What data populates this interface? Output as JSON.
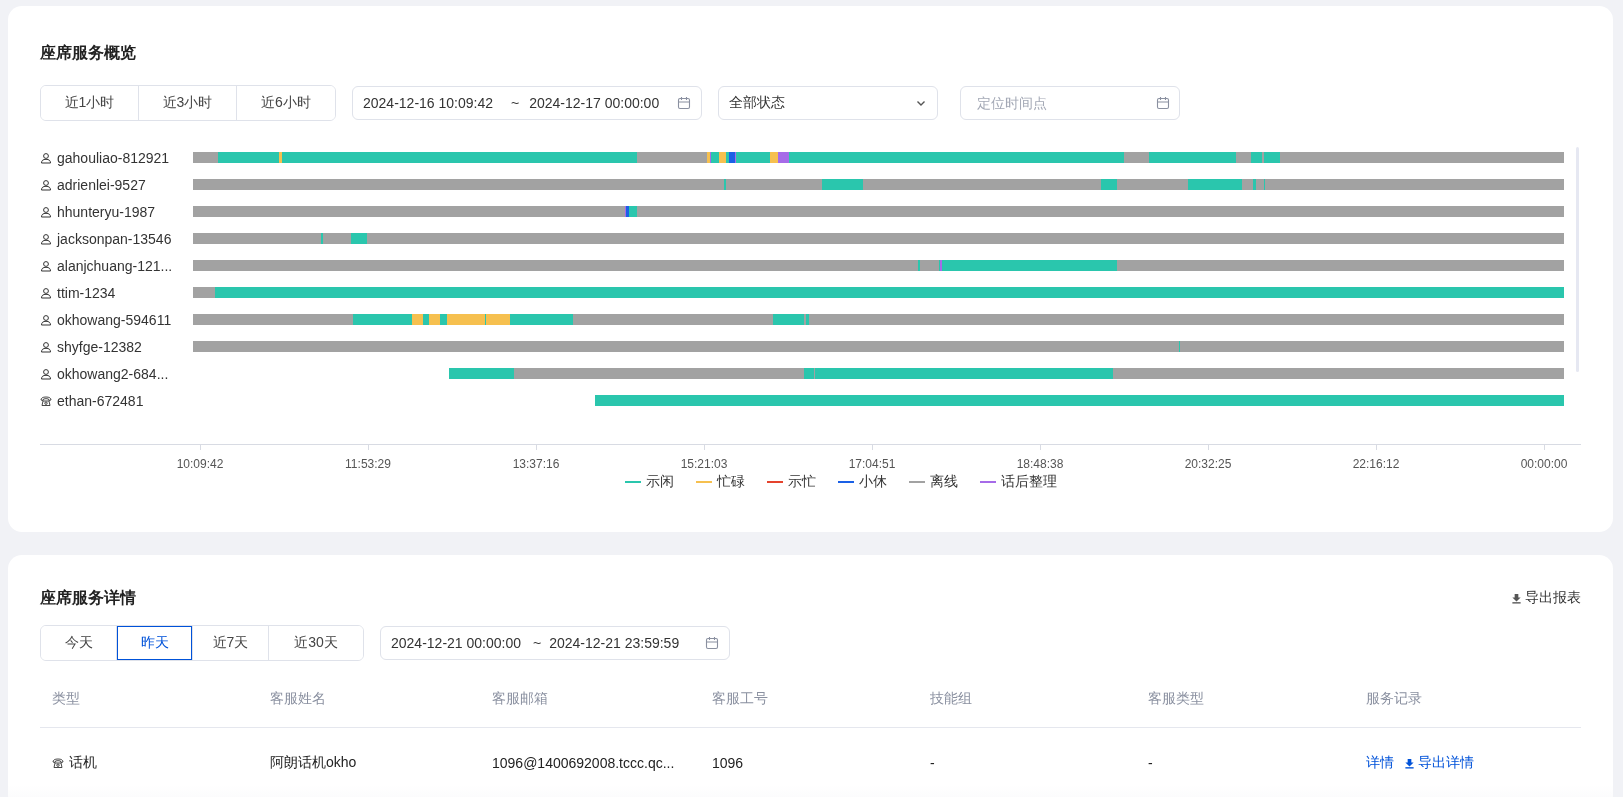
{
  "overview": {
    "title": "座席服务概览",
    "range_tabs": [
      {
        "label": "近1小时",
        "selected": false
      },
      {
        "label": "近3小时",
        "selected": false
      },
      {
        "label": "近6小时",
        "selected": false
      }
    ],
    "date_range": {
      "start": "2024-12-16 10:09:42",
      "separator": "~",
      "end": "2024-12-17 00:00:00"
    },
    "status_select": {
      "value": "全部状态"
    },
    "locate_field": {
      "placeholder": "定位时间点"
    },
    "timeline": {
      "rows": [
        {
          "name": "gahouliao-812921",
          "kind": "person"
        },
        {
          "name": "adrienlei-9527",
          "kind": "person"
        },
        {
          "name": "hhunteryu-1987",
          "kind": "person"
        },
        {
          "name": "jacksonpan-13546",
          "kind": "person"
        },
        {
          "name": "alanjchuang-121...",
          "kind": "person"
        },
        {
          "name": "ttim-1234",
          "kind": "person"
        },
        {
          "name": "okhowang-594611",
          "kind": "person"
        },
        {
          "name": "shyfge-12382",
          "kind": "person"
        },
        {
          "name": "okhowang2-684...",
          "kind": "person"
        },
        {
          "name": "ethan-672481",
          "kind": "phone"
        }
      ],
      "axis_ticks": [
        "10:09:42",
        "11:53:29",
        "13:37:16",
        "15:21:03",
        "17:04:51",
        "18:48:38",
        "20:32:25",
        "22:16:12",
        "00:00:00"
      ],
      "legend": [
        {
          "kind": "idle",
          "label": "示闲",
          "color": "#2ac6ad"
        },
        {
          "kind": "busy",
          "label": "忙碌",
          "color": "#f6c04f"
        },
        {
          "kind": "showbusy",
          "label": "示忙",
          "color": "#e5432d"
        },
        {
          "kind": "break",
          "label": "小休",
          "color": "#1a60e6"
        },
        {
          "kind": "offline",
          "label": "离线",
          "color": "#a2a2a2"
        },
        {
          "kind": "wrapup",
          "label": "话后整理",
          "color": "#a66be8"
        }
      ]
    }
  },
  "details": {
    "title": "座席服务详情",
    "export_button": "导出报表",
    "range_tabs": [
      {
        "label": "今天",
        "selected": false
      },
      {
        "label": "昨天",
        "selected": true
      },
      {
        "label": "近7天",
        "selected": false
      },
      {
        "label": "近30天",
        "selected": false
      }
    ],
    "date_range": {
      "start": "2024-12-21 00:00:00",
      "separator": "~",
      "end": "2024-12-21 23:59:59"
    },
    "table": {
      "columns": [
        "类型",
        "客服姓名",
        "客服邮箱",
        "客服工号",
        "技能组",
        "客服类型",
        "服务记录"
      ],
      "rows": [
        {
          "kind": "phone",
          "type": "话机",
          "name": "阿朗话机okho",
          "email": "1096@1400692008.tccc.qc...",
          "id": "1096",
          "skill_group": "-",
          "agent_type": "-",
          "actions": [
            "详情",
            "导出详情"
          ]
        }
      ]
    }
  }
}
